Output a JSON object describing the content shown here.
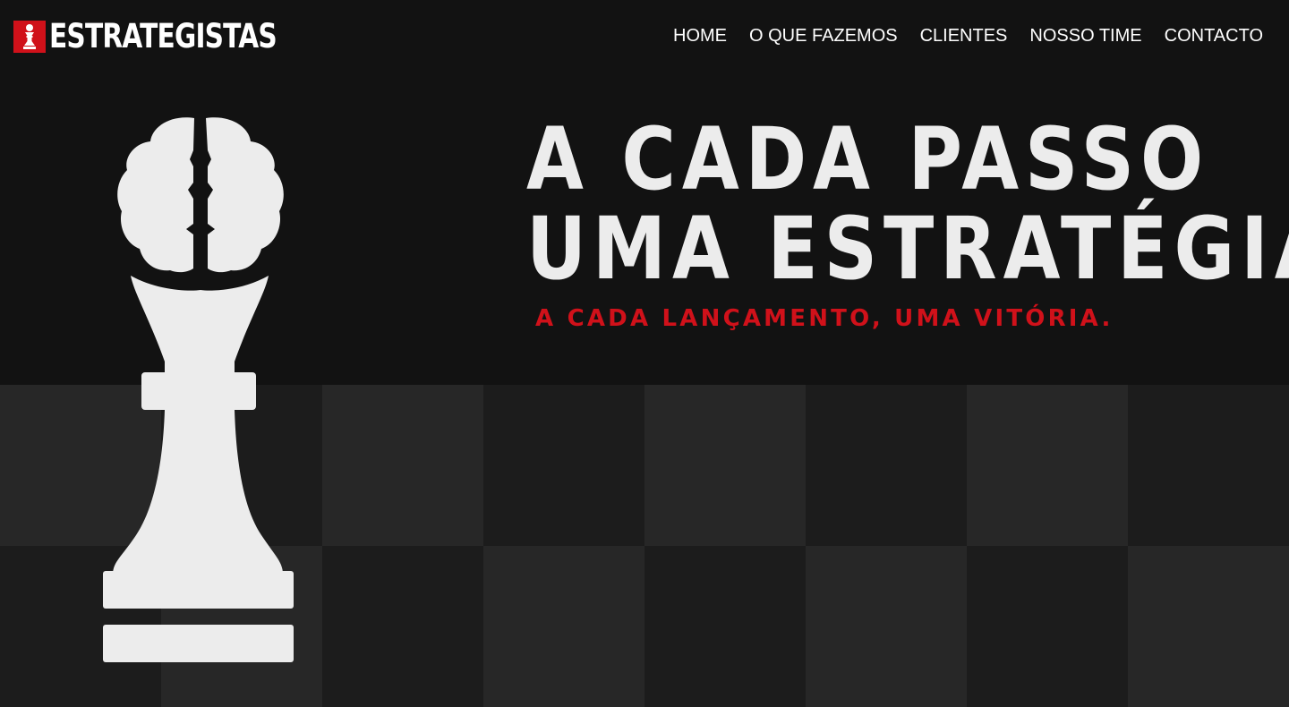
{
  "brand": {
    "logo_text": "ESTRATEGISTAS",
    "logo_icon": "chess-piece-icon",
    "accent_color": "#d0111a"
  },
  "nav": {
    "items": [
      {
        "label": "HOME"
      },
      {
        "label": "O QUE FAZEMOS"
      },
      {
        "label": "CLIENTES"
      },
      {
        "label": "NOSSO TIME"
      },
      {
        "label": "CONTACTO"
      }
    ]
  },
  "hero": {
    "title_line1": "A CADA PASSO",
    "title_line2": "UMA ESTRATÉGIA",
    "subtitle": "A CADA LANÇAMENTO, UMA VITÓRIA.",
    "illustration": "brain-chess-pawn-icon",
    "background_color": "#121212",
    "title_color": "#ececec"
  }
}
